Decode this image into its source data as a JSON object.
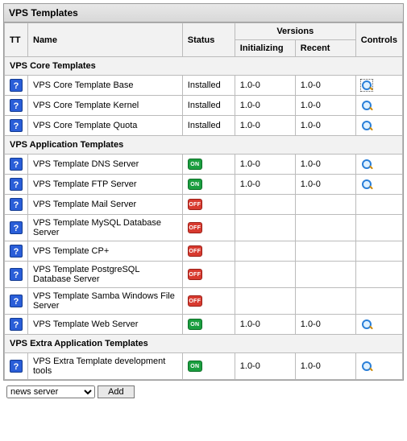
{
  "panel_title": "VPS Templates",
  "columns": {
    "tt": "TT",
    "name": "Name",
    "status": "Status",
    "versions": "Versions",
    "initializing": "Initializing",
    "recent": "Recent",
    "controls": "Controls"
  },
  "sections": [
    {
      "title": "VPS Core Templates",
      "rows": [
        {
          "name": "VPS Core Template Base",
          "status_type": "text",
          "status": "Installed",
          "init": "1.0-0",
          "recent": "1.0-0",
          "ctrl": true,
          "ctrl_focus": true
        },
        {
          "name": "VPS Core Template Kernel",
          "status_type": "text",
          "status": "Installed",
          "init": "1.0-0",
          "recent": "1.0-0",
          "ctrl": true
        },
        {
          "name": "VPS Core Template Quota",
          "status_type": "text",
          "status": "Installed",
          "init": "1.0-0",
          "recent": "1.0-0",
          "ctrl": true
        }
      ]
    },
    {
      "title": "VPS Application Templates",
      "rows": [
        {
          "name": "VPS Template DNS Server",
          "status_type": "on",
          "init": "1.0-0",
          "recent": "1.0-0",
          "ctrl": true
        },
        {
          "name": "VPS Template FTP Server",
          "status_type": "on",
          "init": "1.0-0",
          "recent": "1.0-0",
          "ctrl": true
        },
        {
          "name": "VPS Template Mail Server",
          "status_type": "off",
          "init": "",
          "recent": "",
          "ctrl": false
        },
        {
          "name": "VPS Template MySQL Database Server",
          "status_type": "off",
          "init": "",
          "recent": "",
          "ctrl": false
        },
        {
          "name": "VPS Template CP+",
          "status_type": "off",
          "init": "",
          "recent": "",
          "ctrl": false
        },
        {
          "name": "VPS Template PostgreSQL Database Server",
          "status_type": "off",
          "init": "",
          "recent": "",
          "ctrl": false
        },
        {
          "name": "VPS Template Samba Windows File Server",
          "status_type": "off",
          "init": "",
          "recent": "",
          "ctrl": false
        },
        {
          "name": "VPS Template Web Server",
          "status_type": "on",
          "init": "1.0-0",
          "recent": "1.0-0",
          "ctrl": true
        }
      ]
    },
    {
      "title": "VPS Extra Application Templates",
      "rows": [
        {
          "name": "VPS Extra Template development tools",
          "status_type": "on",
          "init": "1.0-0",
          "recent": "1.0-0",
          "ctrl": true
        }
      ]
    }
  ],
  "bottom": {
    "select_value": "news server",
    "options": [
      "news server"
    ],
    "add_label": "Add"
  },
  "badge_labels": {
    "on": "ON",
    "off": "OFF"
  }
}
